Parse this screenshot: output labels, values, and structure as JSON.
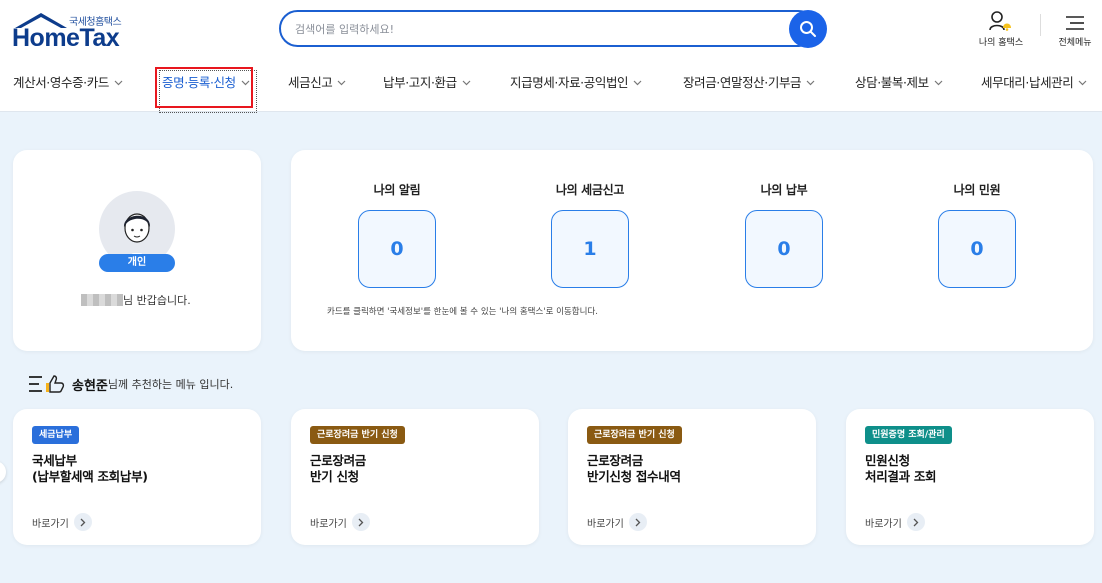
{
  "header": {
    "logo_sub": "국세청홈택스",
    "logo_main": "HomeTax",
    "search_placeholder": "검색어를 입력하세요!",
    "my_hometax_label": "나의 홈택스",
    "all_menu_label": "전체메뉴"
  },
  "nav": {
    "items": [
      {
        "label": "계산서·영수증·카드"
      },
      {
        "label": "증명·등록·신청"
      },
      {
        "label": "세금신고"
      },
      {
        "label": "납부·고지·환급"
      },
      {
        "label": "지급명세·자료·공익법인"
      },
      {
        "label": "장려금·연말정산·기부금"
      },
      {
        "label": "상담·불복·제보"
      },
      {
        "label": "세무대리·납세관리"
      }
    ],
    "active_index": 1
  },
  "profile": {
    "badge": "개인",
    "greeting_suffix": "님 반갑습니다."
  },
  "summary": {
    "items": [
      {
        "label": "나의 알림",
        "value": "0"
      },
      {
        "label": "나의 세금신고",
        "value": "1"
      },
      {
        "label": "나의 납부",
        "value": "0"
      },
      {
        "label": "나의 민원",
        "value": "0"
      }
    ],
    "note": "카드를 클릭하면 '국세정보'를 한눈에 볼 수 있는 '나의 홈택스'로 이동합니다."
  },
  "recommend": {
    "user_name": "송현준",
    "suffix": "님께 추천하는 메뉴 입니다.",
    "cards": [
      {
        "tag": "세금납부",
        "tag_color": "#2a6fdb",
        "title_line1": "국세납부",
        "title_line2": "(납부할세액 조회납부)",
        "link": "바로가기"
      },
      {
        "tag": "근로장려금 반기 신청",
        "tag_color": "#8a5a12",
        "title_line1": "근로장려금",
        "title_line2": "반기 신청",
        "link": "바로가기"
      },
      {
        "tag": "근로장려금 반기 신청",
        "tag_color": "#8a5a12",
        "title_line1": "근로장려금",
        "title_line2": "반기신청 접수내역",
        "link": "바로가기"
      },
      {
        "tag": "민원증명 조회/관리",
        "tag_color": "#0e8f8a",
        "title_line1": "민원신청",
        "title_line2": "처리결과 조회",
        "link": "바로가기"
      }
    ]
  },
  "colors": {
    "accent": "#2a7ee8",
    "brand": "#0d3c8c",
    "highlight": "#e8171e"
  }
}
